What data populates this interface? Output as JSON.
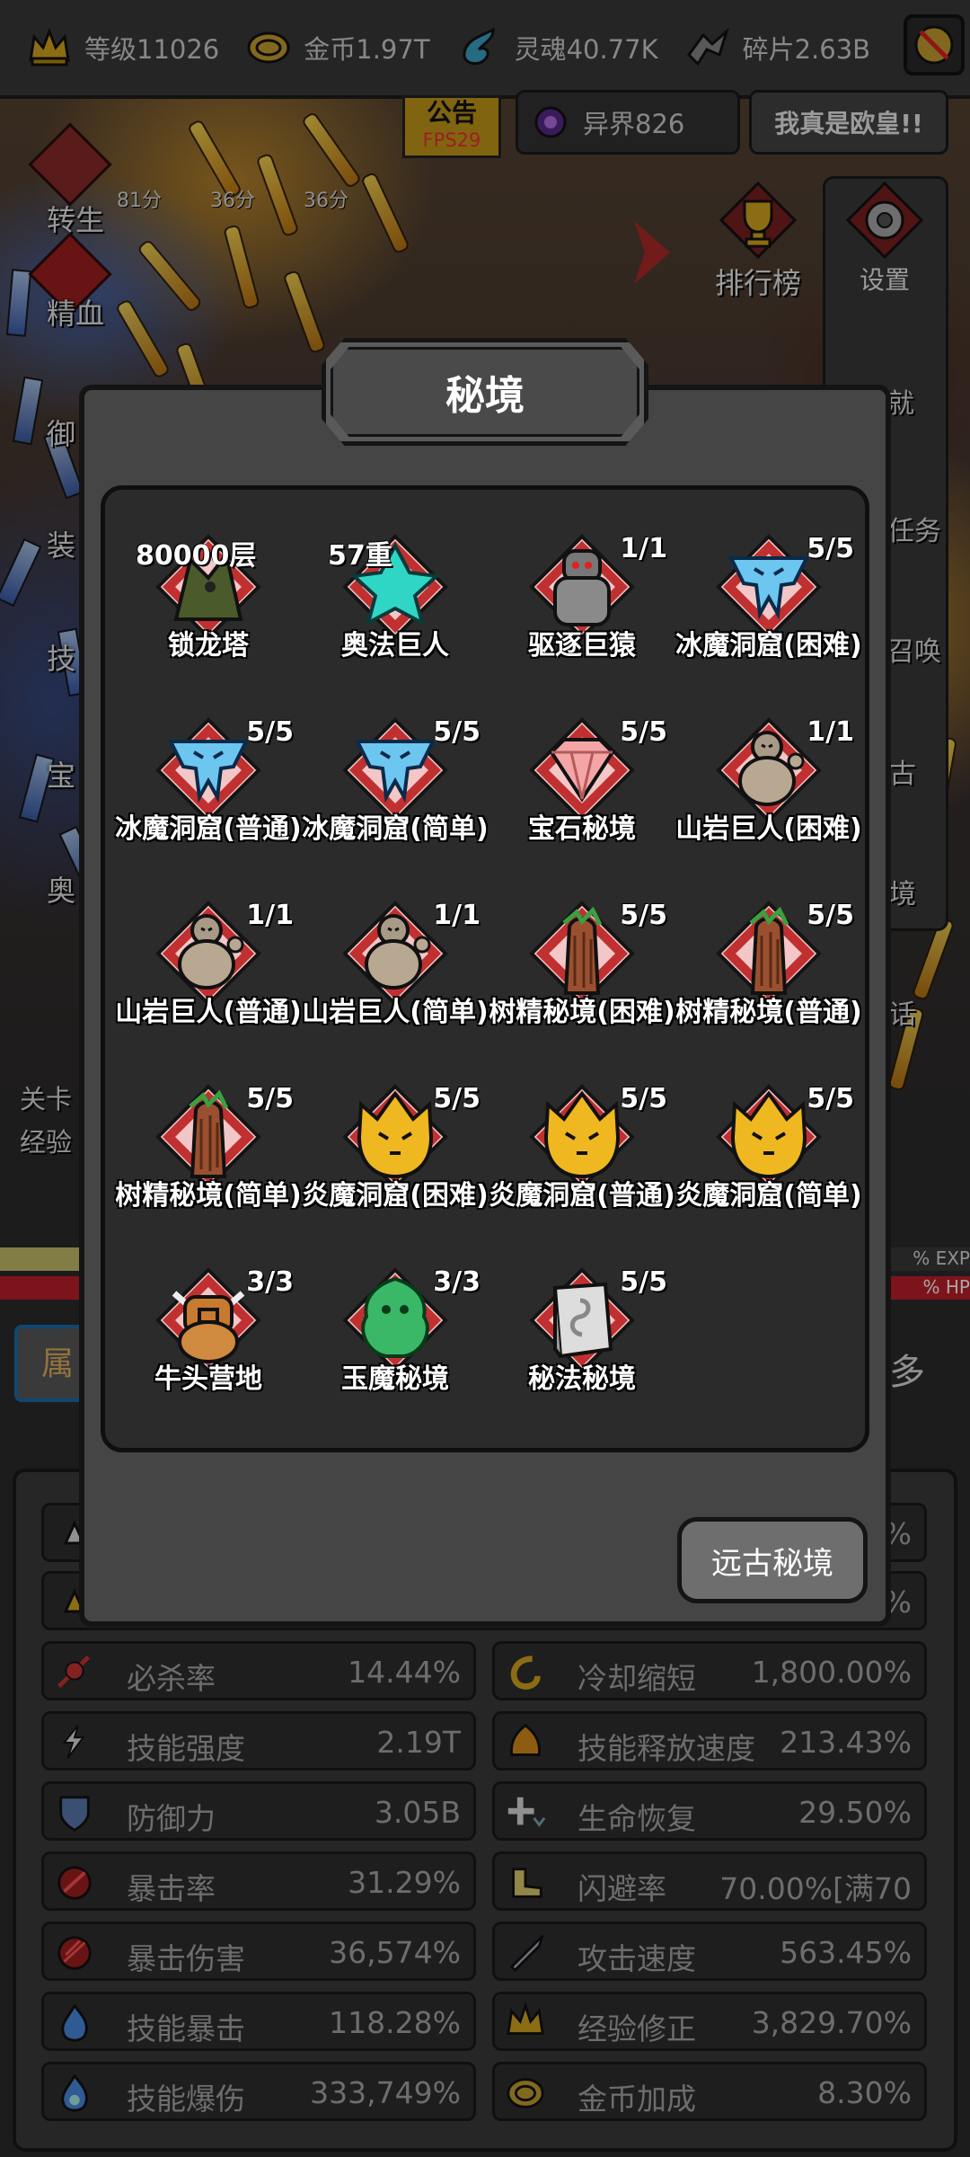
{
  "resources": [
    {
      "label": "等级11026",
      "icon": "crown-icon"
    },
    {
      "label": "金币1.97T",
      "icon": "coin-icon"
    },
    {
      "label": "灵魂40.77K",
      "icon": "soul-icon"
    },
    {
      "label": "碎片2.63B",
      "icon": "shard-icon"
    }
  ],
  "notice": {
    "title": "公告",
    "fps": "FPS29"
  },
  "otherworld": {
    "label": "异界826"
  },
  "lucky": {
    "label": "我真是欧皇!!"
  },
  "side_menu": [
    "转生",
    "精血",
    "御",
    "装",
    "技",
    "宝",
    "奥"
  ],
  "timers": [
    "81分",
    "36分",
    "36分"
  ],
  "rank": {
    "label": "排行榜"
  },
  "settings": {
    "label": "设置"
  },
  "right_partials": [
    "就",
    "任务",
    "召唤",
    "古",
    "境",
    "话"
  ],
  "left_partials": {
    "stage": "关卡",
    "exp": "经验"
  },
  "bar_labels": {
    "exp": "% EXP",
    "hp": "% HP"
  },
  "tabs": {
    "left": "属",
    "right": "多"
  },
  "modal": {
    "title": "秘境",
    "dungeons": [
      {
        "name": "锁龙塔",
        "count": "80000层",
        "count_pos": "left",
        "icon": "dragon-tower-icon"
      },
      {
        "name": "奥法巨人",
        "count": "57重",
        "count_pos": "left",
        "icon": "arcane-giant-icon"
      },
      {
        "name": "驱逐巨猿",
        "count": "1/1",
        "count_pos": "right",
        "icon": "giant-ape-icon"
      },
      {
        "name": "冰魔洞窟(困难)",
        "count": "5/5",
        "count_pos": "right",
        "icon": "ice-demon-icon"
      },
      {
        "name": "冰魔洞窟(普通)",
        "count": "5/5",
        "count_pos": "right",
        "icon": "ice-demon-icon"
      },
      {
        "name": "冰魔洞窟(简单)",
        "count": "5/5",
        "count_pos": "right",
        "icon": "ice-demon-icon"
      },
      {
        "name": "宝石秘境",
        "count": "5/5",
        "count_pos": "right",
        "icon": "gem-icon"
      },
      {
        "name": "山岩巨人(困难)",
        "count": "1/1",
        "count_pos": "right",
        "icon": "rock-giant-icon"
      },
      {
        "name": "山岩巨人(普通)",
        "count": "1/1",
        "count_pos": "right",
        "icon": "rock-giant-icon"
      },
      {
        "name": "山岩巨人(简单)",
        "count": "1/1",
        "count_pos": "right",
        "icon": "rock-giant-icon"
      },
      {
        "name": "树精秘境(困难)",
        "count": "5/5",
        "count_pos": "right",
        "icon": "treant-icon"
      },
      {
        "name": "树精秘境(普通)",
        "count": "5/5",
        "count_pos": "right",
        "icon": "treant-icon"
      },
      {
        "name": "树精秘境(简单)",
        "count": "5/5",
        "count_pos": "right",
        "icon": "treant-icon"
      },
      {
        "name": "炎魔洞窟(困难)",
        "count": "5/5",
        "count_pos": "right",
        "icon": "fire-demon-icon"
      },
      {
        "name": "炎魔洞窟(普通)",
        "count": "5/5",
        "count_pos": "right",
        "icon": "fire-demon-icon"
      },
      {
        "name": "炎魔洞窟(简单)",
        "count": "5/5",
        "count_pos": "right",
        "icon": "fire-demon-icon"
      },
      {
        "name": "牛头营地",
        "count": "3/3",
        "count_pos": "right",
        "icon": "minotaur-icon"
      },
      {
        "name": "玉魔秘境",
        "count": "3/3",
        "count_pos": "right",
        "icon": "jade-demon-icon"
      },
      {
        "name": "秘法秘境",
        "count": "5/5",
        "count_pos": "right",
        "icon": "arcane-book-icon"
      }
    ],
    "ancient_button": "远古秘境"
  },
  "stats_partial": [
    "%",
    "%"
  ],
  "stats": [
    {
      "name": "必杀率",
      "value": "14.44%",
      "icon": "kill-icon"
    },
    {
      "name": "冷却缩短",
      "value": "1,800.00%",
      "icon": "cooldown-icon"
    },
    {
      "name": "技能强度",
      "value": "2.19T",
      "icon": "lightning-icon"
    },
    {
      "name": "技能释放速度",
      "value": "213.43%",
      "icon": "cast-speed-icon"
    },
    {
      "name": "防御力",
      "value": "3.05B",
      "icon": "shield-icon"
    },
    {
      "name": "生命恢复",
      "value": "29.50%",
      "icon": "regen-icon"
    },
    {
      "name": "暴击率",
      "value": "31.29%",
      "icon": "crit-icon"
    },
    {
      "name": "闪避率",
      "value": "70.00%[满70",
      "icon": "boot-icon"
    },
    {
      "name": "暴击伤害",
      "value": "36,574%",
      "icon": "crit-damage-icon"
    },
    {
      "name": "攻击速度",
      "value": "563.45%",
      "icon": "sword-icon"
    },
    {
      "name": "技能暴击",
      "value": "118.28%",
      "icon": "skill-crit-icon"
    },
    {
      "name": "经验修正",
      "value": "3,829.70%",
      "icon": "crown-icon"
    },
    {
      "name": "技能爆伤",
      "value": "333,749%",
      "icon": "skill-burst-icon"
    },
    {
      "name": "金币加成",
      "value": "8.30%",
      "icon": "coin-icon"
    }
  ]
}
